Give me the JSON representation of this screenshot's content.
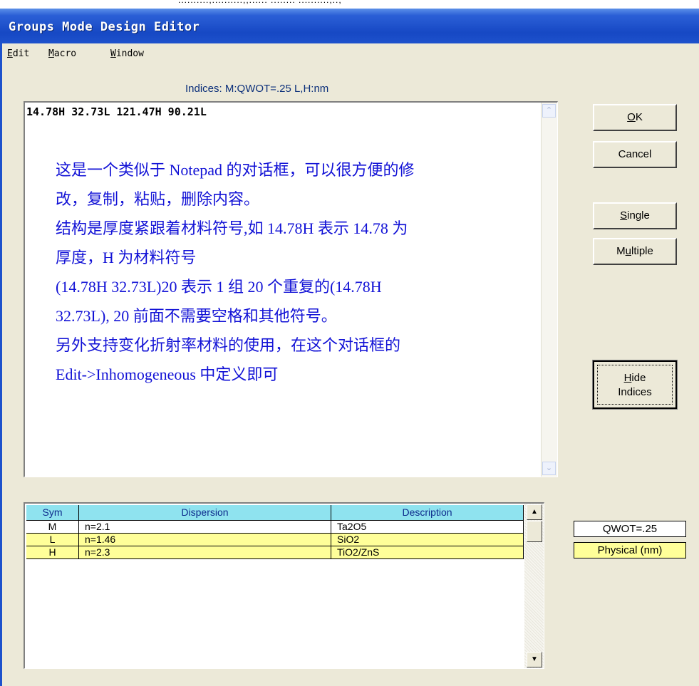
{
  "window": {
    "title": "Groups Mode Design Editor",
    "top_strip_text": "..........,..........,,...... ........ ..........,..,"
  },
  "menu": {
    "items": [
      {
        "label_rest": "dit",
        "accel": "E"
      },
      {
        "label_rest": "acro",
        "accel": "M"
      },
      {
        "label_rest": "indow",
        "accel": "W"
      }
    ]
  },
  "indices_label": "Indices: M:QWOT=.25  L,H:nm",
  "editor": {
    "content": "14.78H 32.73L 121.47H 90.21L",
    "notes": [
      "这是一个类似于 Notepad 的对话框，可以很方便的修",
      "改，复制，粘贴，删除内容。",
      "结构是厚度紧跟着材料符号,如 14.78H 表示 14.78 为",
      "厚度，H 为材料符号",
      "(14.78H  32.73L)20  表示  1  组  20  个重复的(14.78H",
      "32.73L), 20 前面不需要空格和其他符号。",
      "另外支持变化折射率材料的使用，在这个对话框的",
      "Edit->Inhomogeneous 中定义即可"
    ]
  },
  "buttons": {
    "ok": {
      "accel": "O",
      "rest": "K"
    },
    "cancel": "Cancel",
    "single": {
      "accel": "S",
      "rest": "ingle"
    },
    "multiple": {
      "pre": "M",
      "accel": "u",
      "rest": "ltiple"
    },
    "hide": {
      "accel": "H",
      "line1_rest": "ide",
      "line2": "Indices"
    }
  },
  "table": {
    "headers": [
      "Sym",
      "Dispersion",
      "Description"
    ],
    "rows": [
      {
        "sym": "M",
        "dispersion": "n=2.1",
        "description": "Ta2O5"
      },
      {
        "sym": "L",
        "dispersion": "n=1.46",
        "description": "SiO2"
      },
      {
        "sym": "H",
        "dispersion": "n=2.3",
        "description": "TiO2/ZnS"
      }
    ],
    "scroll_up": "▲",
    "scroll_down": "▼"
  },
  "units": {
    "qwot": "QWOT=.25",
    "physical": "Physical (nm)"
  },
  "colors": {
    "titlebar": "#1648c4",
    "note_text": "#1212d6",
    "table_header": "#8fe3ef",
    "highlight_row": "#ffff99"
  }
}
